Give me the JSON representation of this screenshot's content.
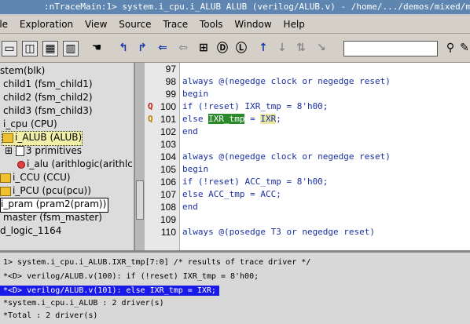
{
  "window": {
    "title": ":nTraceMain:1> system.i_cpu.i_ALUB ALUB (verilog/ALUB.v) - /home/.../demos/mixed/mi"
  },
  "menu": [
    "ile",
    "Exploration",
    "View",
    "Source",
    "Trace",
    "Tools",
    "Window",
    "Help"
  ],
  "toolbar": {
    "icons": [
      "window-icon",
      "split-window-icon",
      "window-grid-icon",
      "window-pane-icon",
      "hand-icon",
      "trace-driver-icon",
      "trace-load-icon",
      "trace-connect-icon",
      "trace-back-icon",
      "schematic-icon",
      "driver-d-icon",
      "load-l-icon",
      "arrow-up-icon",
      "arrow-down-icon",
      "arrow-split-icon",
      "arrow-down-right-icon",
      "find-icon",
      "pencil-icon"
    ],
    "search_value": ""
  },
  "tree": [
    {
      "label": "stem(blk)",
      "indent": 0,
      "icon": "none"
    },
    {
      "label": "child1 (fsm_child1)",
      "indent": 0,
      "icon": "none"
    },
    {
      "label": "child2 (fsm_child2)",
      "indent": 0,
      "icon": "none"
    },
    {
      "label": "child3 (fsm_child3)",
      "indent": 0,
      "icon": "none"
    },
    {
      "label": "i_cpu (CPU)",
      "indent": 0,
      "icon": "none"
    },
    {
      "label": "i_ALUB (ALUB)",
      "indent": 1,
      "icon": "folder",
      "selected": true
    },
    {
      "label": "3 primitives",
      "indent": 2,
      "icon": "doc"
    },
    {
      "label": "i_alu (arithlogic(arithlc",
      "indent": 2,
      "icon": "red"
    },
    {
      "label": "i_CCU (CCU)",
      "indent": 0,
      "icon": "folder"
    },
    {
      "label": "i_PCU (pcu(pcu))",
      "indent": 0,
      "icon": "folder"
    },
    {
      "label": "i_pram (pram2(pram))",
      "indent": 0,
      "icon": "none",
      "boxed": true
    },
    {
      "label": "master (fsm_master)",
      "indent": 0,
      "icon": "none"
    },
    {
      "label": "d_logic_1164",
      "indent": 0,
      "icon": "none"
    }
  ],
  "code": [
    {
      "ln": "97",
      "mark": "",
      "pre": "",
      "hl": "",
      "mid": "",
      "hl2": "",
      "post": ""
    },
    {
      "ln": "98",
      "mark": "",
      "pre": "always @(negedge clock or negedge reset)",
      "hl": "",
      "mid": "",
      "hl2": "",
      "post": ""
    },
    {
      "ln": "99",
      "mark": "",
      "pre": " begin",
      "hl": "",
      "mid": "",
      "hl2": "",
      "post": ""
    },
    {
      "ln": "100",
      "mark": "Q",
      "pre": "        if (!reset) IXR_tmp = 8'h00;",
      "hl": "",
      "mid": "",
      "hl2": "",
      "post": ""
    },
    {
      "ln": "101",
      "mark": "Q",
      "pre": "        else ",
      "hl": "IXR_tmp",
      "mid": " = ",
      "hl2": "IXR",
      "post": ";"
    },
    {
      "ln": "102",
      "mark": "",
      "pre": " end",
      "hl": "",
      "mid": "",
      "hl2": "",
      "post": ""
    },
    {
      "ln": "103",
      "mark": "",
      "pre": "",
      "hl": "",
      "mid": "",
      "hl2": "",
      "post": ""
    },
    {
      "ln": "104",
      "mark": "",
      "pre": "always @(negedge clock or negedge reset)",
      "hl": "",
      "mid": "",
      "hl2": "",
      "post": ""
    },
    {
      "ln": "105",
      "mark": "",
      "pre": " begin",
      "hl": "",
      "mid": "",
      "hl2": "",
      "post": ""
    },
    {
      "ln": "106",
      "mark": "",
      "pre": "        if (!reset) ACC_tmp = 8'h00;",
      "hl": "",
      "mid": "",
      "hl2": "",
      "post": ""
    },
    {
      "ln": "107",
      "mark": "",
      "pre": "        else ACC_tmp = ACC;",
      "hl": "",
      "mid": "",
      "hl2": "",
      "post": ""
    },
    {
      "ln": "108",
      "mark": "",
      "pre": " end",
      "hl": "",
      "mid": "",
      "hl2": "",
      "post": ""
    },
    {
      "ln": "109",
      "mark": "",
      "pre": "",
      "hl": "",
      "mid": "",
      "hl2": "",
      "post": ""
    },
    {
      "ln": "110",
      "mark": "",
      "pre": "always @(posedge T3 or negedge reset)",
      "hl": "",
      "mid": "",
      "hl2": "",
      "post": ""
    }
  ],
  "results": [
    {
      "text": "1> system.i_cpu.i_ALUB.IXR_tmp[7:0] /* results of trace driver */",
      "selected": false
    },
    {
      "text": "       *<D> verilog/ALUB.v(100): if (!reset) IXR_tmp = 8'h00;",
      "selected": false
    },
    {
      "text": "       *<D> verilog/ALUB.v(101): else IXR_tmp = IXR;",
      "selected": true
    },
    {
      "text": "*system.i_cpu.i_ALUB :                    2 driver(s)",
      "selected": false
    },
    {
      "text": "*Total  :                                 2 driver(s)",
      "selected": false
    }
  ]
}
